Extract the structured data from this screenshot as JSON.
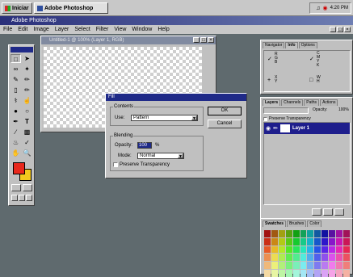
{
  "taskbar": {
    "start_label": "Iniciar",
    "app_task_label": "Adobe Photoshop",
    "clock": "4:20 PM"
  },
  "window": {
    "title": "Adobe Photoshop"
  },
  "menu": [
    "File",
    "Edit",
    "Image",
    "Layer",
    "Select",
    "Filter",
    "View",
    "Window",
    "Help"
  ],
  "document": {
    "title": "Untitled-1 @ 100% (Layer 1, RGB)"
  },
  "fill_dialog": {
    "title": "Fill",
    "contents_label": "Contents",
    "use_label": "Use:",
    "use_value": "Pattern",
    "blending_label": "Blending",
    "opacity_label": "Opacity:",
    "opacity_value": "100",
    "opacity_unit": "%",
    "mode_label": "Mode:",
    "mode_value": "Normal",
    "preserve_label": "Preserve Transparency",
    "ok_label": "OK",
    "cancel_label": "Cancel"
  },
  "navigator_panel": {
    "tabs": [
      "Navigator",
      "Info",
      "Options"
    ],
    "active": "Info",
    "readouts": [
      {
        "keys": "R\nG\nB",
        "icon": "eyedropper"
      },
      {
        "keys": "C\nM\nY\nK",
        "icon": "eyedropper"
      },
      {
        "keys": "X\nY",
        "icon": "crosshair"
      },
      {
        "keys": "W\nH",
        "icon": "selection"
      }
    ]
  },
  "layers_panel": {
    "tabs": [
      "Layers",
      "Channels",
      "Paths",
      "Actions"
    ],
    "active": "Layers",
    "opacity_label": "Opacity:",
    "opacity_value": "100%",
    "preserve_label": "Preserve Transparency",
    "layer_name": "Layer 1"
  },
  "swatches_panel": {
    "tabs": [
      "Swatches",
      "Brushes",
      "Color"
    ],
    "active": "Swatches"
  },
  "colors": {
    "foreground": "#e8281c",
    "background": "#f2c81e",
    "layer_highlight": "#1e1e8c"
  }
}
